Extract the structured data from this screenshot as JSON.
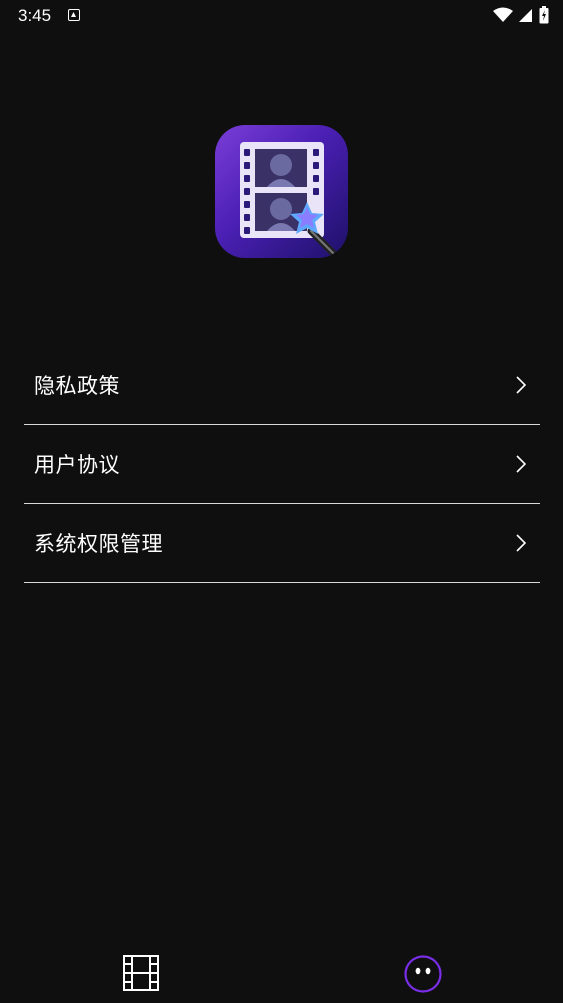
{
  "status_bar": {
    "time": "3:45",
    "icons": [
      "notification-a-icon",
      "wifi-icon",
      "signal-icon",
      "battery-icon"
    ]
  },
  "app": {
    "logo_icon": "video-editor-logo-icon",
    "accent_color": "#6a2fd6"
  },
  "menu": {
    "items": [
      {
        "label": "隐私政策",
        "icon": "chevron-right-icon"
      },
      {
        "label": "用户协议",
        "icon": "chevron-right-icon"
      },
      {
        "label": "系统权限管理",
        "icon": "chevron-right-icon"
      }
    ]
  },
  "bottom_nav": {
    "tabs": [
      {
        "icon": "film-strip-icon",
        "selected": false
      },
      {
        "icon": "smiley-face-icon",
        "selected": true,
        "color": "#7a2ee8"
      }
    ]
  }
}
